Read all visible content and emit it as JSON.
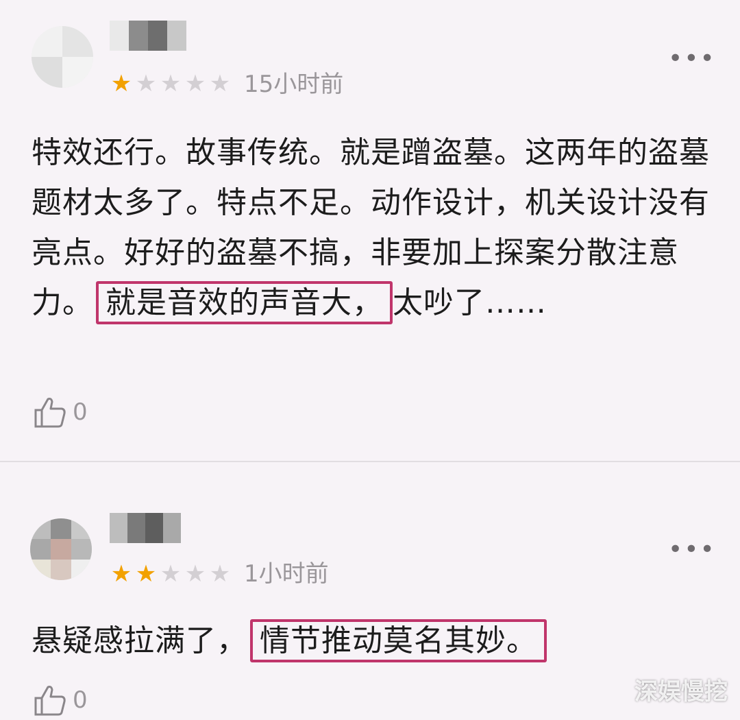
{
  "reviews": [
    {
      "rating": 1,
      "time": "15小时前",
      "text_before": "特效还行。故事传统。就是蹭盗墓。这两年的盗墓题材太多了。特点不足。动作设计，机关设计没有亮点。好好的盗墓不搞，非要加上探案分散注意力。",
      "text_highlight": "就是音效的声音大，",
      "text_after": "太吵了……",
      "likes": "0"
    },
    {
      "rating": 2,
      "time": "1小时前",
      "text_before": "悬疑感拉满了，",
      "text_highlight": "情节推动莫名其妙。",
      "text_after": "",
      "likes": "0"
    }
  ],
  "watermark": "深娱慢挖",
  "colors": {
    "star_on": "#f2a100",
    "star_off": "#d3cfd3",
    "highlight_border": "#c0356b",
    "background": "#f7f3f7"
  },
  "icons": {
    "more": "more-dots-icon",
    "like": "thumbs-up-icon",
    "star": "star-icon"
  }
}
